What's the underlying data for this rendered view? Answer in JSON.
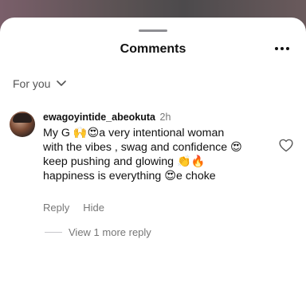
{
  "header": {
    "title": "Comments",
    "more_icon": "more-horizontal-icon"
  },
  "filter": {
    "label": "For you",
    "icon": "chevron-down-icon"
  },
  "comment": {
    "username": "ewagoyintide_abeokuta",
    "time": "2h",
    "text": "My G 🙌😍a very intentional woman\nwith the vibes , swag and confidence 😍\nkeep pushing and glowing 👏🔥\nhappiness is everything 😍e choke",
    "reply_label": "Reply",
    "hide_label": "Hide",
    "like_icon": "heart-outline-icon",
    "avatar_icon": "avatar"
  },
  "replies": {
    "label": "View 1 more reply"
  },
  "colors": {
    "sheet": "#ffffff",
    "text": "#111111",
    "muted": "#777777"
  }
}
